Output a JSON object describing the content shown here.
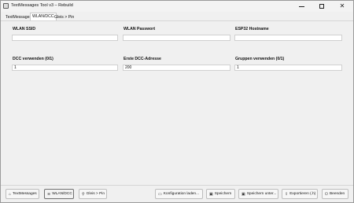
{
  "window": {
    "title": "TextMessages Tool v3 – Rebuild",
    "controls": {
      "minimize_icon": "minimize-icon",
      "maximize_icon": "maximize-icon",
      "close_glyph": "✕"
    }
  },
  "tabs": [
    {
      "label": "TextMessages",
      "active": false
    },
    {
      "label": "WLAN/DCC",
      "active": true
    },
    {
      "label": "Gleis > Pin",
      "active": false
    }
  ],
  "form": {
    "wlan_ssid": {
      "label": "WLAN SSID",
      "value": ""
    },
    "wlan_password": {
      "label": "WLAN Passwort",
      "value": ""
    },
    "esp32_hostname": {
      "label": "ESP32 Hostname",
      "value": ""
    },
    "dcc_enabled": {
      "label": "DCC verwenden (0/1)",
      "value": "1"
    },
    "first_dcc_address": {
      "label": "Erste DCC-Adresse",
      "value": "200"
    },
    "groups_enabled": {
      "label": "Gruppen verwenden (0/1)",
      "value": "1"
    }
  },
  "footer": {
    "nav_buttons": [
      {
        "label": "TextMessages",
        "icon": "home-icon",
        "active": false
      },
      {
        "label": "WLAN/DCC",
        "icon": "wifi-icon",
        "active": true
      },
      {
        "label": "Gleis > Pin",
        "icon": "pin-icon",
        "active": false
      }
    ],
    "action_buttons": [
      {
        "label": "Konfiguration laden...",
        "icon": "folder-open-icon"
      },
      {
        "label": "Speichern",
        "icon": "save-icon"
      },
      {
        "label": "Speichern unter...",
        "icon": "save-as-icon"
      },
      {
        "label": "Exportieren (.h)",
        "icon": "export-icon"
      },
      {
        "label": "Beenden",
        "icon": "power-icon"
      }
    ]
  }
}
